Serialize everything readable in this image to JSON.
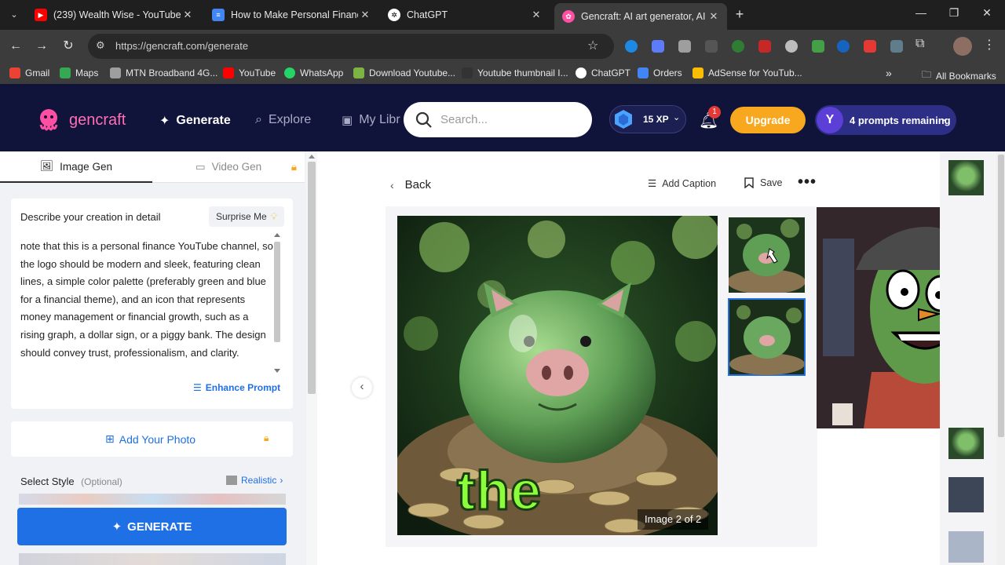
{
  "browser": {
    "tabs": [
      {
        "title": "(239) Wealth Wise - YouTube",
        "close": "✕"
      },
      {
        "title": "How to Make Personal Finance",
        "close": "✕"
      },
      {
        "title": "ChatGPT",
        "close": "✕"
      },
      {
        "title": "Gencraft: AI art generator, AI ph",
        "close": "✕"
      }
    ],
    "new_tab": "+",
    "url": "https://gencraft.com/generate",
    "bookmarks": [
      "Gmail",
      "Maps",
      "MTN Broadband 4G...",
      "YouTube",
      "WhatsApp",
      "Download Youtube...",
      "Youtube thumbnail I...",
      "ChatGPT",
      "Orders",
      "AdSense for YouTub..."
    ],
    "all_bookmarks": "All Bookmarks"
  },
  "header": {
    "logo": "gencraft",
    "nav": {
      "generate": "Generate",
      "explore": "Explore",
      "library": "My Libr"
    },
    "search_placeholder": "Search...",
    "xp": "15 XP",
    "notifications": "1",
    "upgrade": "Upgrade",
    "avatar_letter": "Y",
    "prompts": "4 prompts remaining"
  },
  "left": {
    "tab_image": "Image Gen",
    "tab_video": "Video Gen",
    "describe_label": "Describe your creation in detail",
    "surprise": "Surprise Me",
    "prompt_text": "note that this is a personal finance YouTube channel, so the logo should be modern and sleek, featuring clean lines, a simple color palette (preferably green and blue for a financial theme), and an icon that represents money management or financial growth, such as a rising graph, a dollar sign, or a piggy bank. The design should convey trust, professionalism, and clarity.",
    "enhance": "Enhance Prompt",
    "add_photo": "Add Your Photo",
    "select_style": "Select Style",
    "optional": "(Optional)",
    "style_value": "Realistic",
    "generate": "GENERATE"
  },
  "main": {
    "back": "Back",
    "add_caption": "Add Caption",
    "save": "Save",
    "caption_overlay": "the",
    "image_counter": "Image 2 of 2"
  },
  "colors": {
    "header_bg": "#10133a",
    "accent_blue": "#1f6fe5",
    "upgrade": "#f7a81f",
    "logo_pink": "#ff4fa3"
  }
}
